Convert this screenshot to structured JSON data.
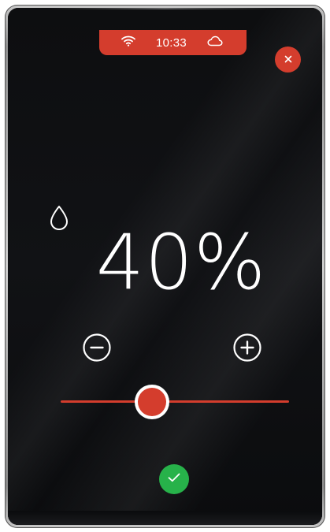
{
  "status_bar": {
    "time": "10:33",
    "wifi_icon": "wifi-icon",
    "cloud_icon": "cloud-icon",
    "color": "#d43d2d"
  },
  "close_button": {
    "icon": "close-icon",
    "label": "×"
  },
  "setting": {
    "icon": "water-drop-icon",
    "value_text": "40%",
    "value_fraction": 0.4
  },
  "controls": {
    "decrease_icon": "minus-circle-icon",
    "increase_icon": "plus-circle-icon",
    "confirm_icon": "checkmark-icon"
  },
  "colors": {
    "accent": "#d43d2d",
    "confirm": "#27b24a",
    "background": "#0d0e10"
  }
}
